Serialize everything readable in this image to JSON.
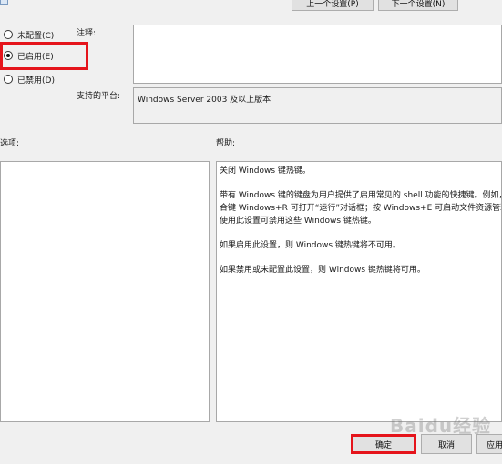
{
  "toolbar": {
    "prev_label": "上一个设置(P)",
    "next_label": "下一个设置(N)"
  },
  "state": {
    "options": [
      {
        "label": "未配置(C)",
        "selected": false
      },
      {
        "label": "已启用(E)",
        "selected": true
      },
      {
        "label": "已禁用(D)",
        "selected": false
      }
    ]
  },
  "labels": {
    "comment": "注释:",
    "supported_platform": "支持的平台:",
    "options": "选项:",
    "help": "帮助:"
  },
  "fields": {
    "comment_value": "",
    "platform_value": "Windows Server 2003 及以上版本"
  },
  "help_text": [
    "关闭 Windows 键热键。",
    "带有 Windows 键的键盘为用户提供了启用常见的 shell 功能的快捷键。例如，按组合键 Windows+R 可打开“运行”对话框；按 Windows+E 可启动文件资源管理器。使用此设置可禁用这些 Windows 键热键。",
    "如果启用此设置，则 Windows 键热键将不可用。",
    "如果禁用或未配置此设置，则 Windows 键热键将可用。"
  ],
  "buttons": {
    "ok": "确定",
    "cancel": "取消",
    "apply": "应用"
  },
  "watermark": "Baidu经验",
  "colors": {
    "highlight": "#e5141b",
    "window_bg": "#f0f0f0"
  }
}
